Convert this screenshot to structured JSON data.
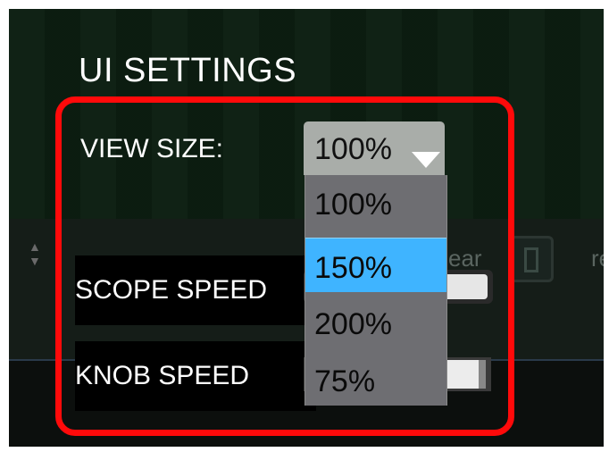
{
  "panel": {
    "title": "UI SETTINGS",
    "background_hints": {
      "partial_text_right": "ear",
      "partial_text_far_right": "re"
    }
  },
  "settings": {
    "view_size": {
      "label": "VIEW SIZE:",
      "current_value": "100%",
      "options": [
        "100%",
        "150%",
        "200%",
        "75%"
      ],
      "highlighted_option": "150%"
    },
    "scope_speed": {
      "label": "SCOPE SPEED"
    },
    "knob_speed": {
      "label": "KNOB SPEED"
    }
  },
  "colors": {
    "accent": "#3fb4ff",
    "highlight_frame": "#ff0a0a",
    "panel_background": "#0a1a0f",
    "text": "#ffffff"
  },
  "icons": {
    "dropdown_caret": "caret-down-icon",
    "stepper_arrows": "up-down-arrows-icon"
  }
}
